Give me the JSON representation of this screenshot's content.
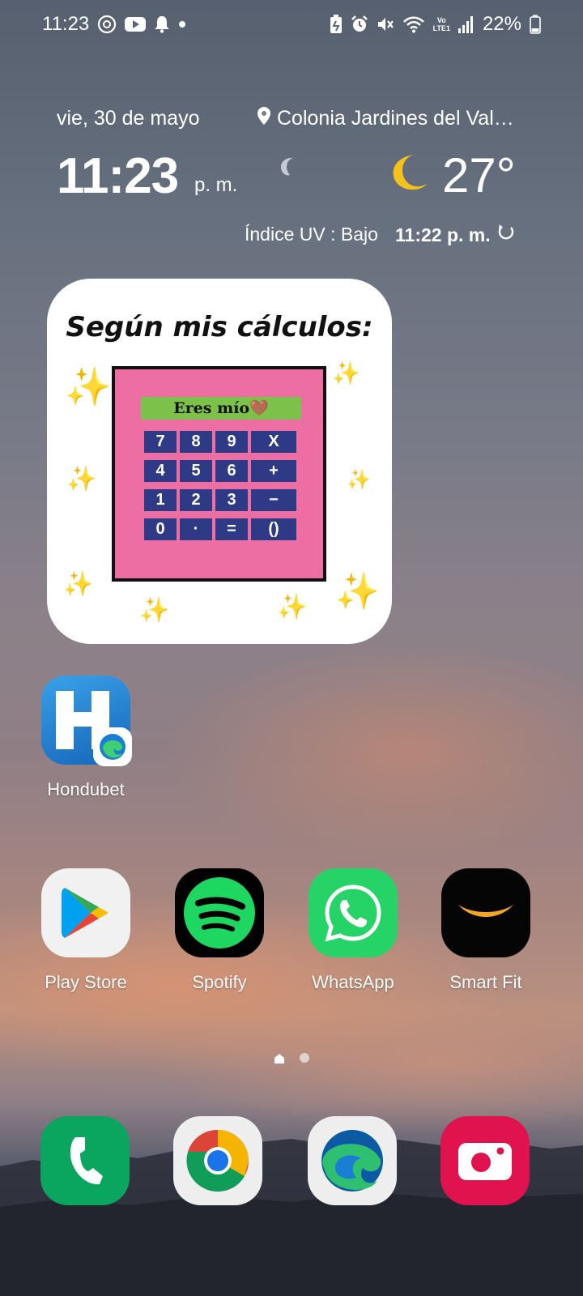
{
  "status_bar": {
    "time": "11:23",
    "battery": "22%",
    "left_icons": [
      "data-saver-icon",
      "youtube-icon",
      "bell-icon",
      "dot-icon"
    ],
    "right_icons": [
      "battery-saver-icon",
      "alarm-icon",
      "mute-icon",
      "wifi-icon",
      "volte-icon",
      "signal-icon",
      "battery-icon"
    ],
    "volte_top": "Vo",
    "volte_bottom": "LTE1"
  },
  "weather": {
    "date": "vie, 30 de mayo",
    "location": "Colonia Jardines del Val…",
    "time": "11:23",
    "ampm": "p. m.",
    "temperature": "27°",
    "uv": "Índice UV : Bajo",
    "updated": "11:22 p. m."
  },
  "photo_widget": {
    "title": "Según mis cálculos:",
    "display": "Eres mío🤎",
    "keys": [
      "7",
      "8",
      "9",
      "X",
      "4",
      "5",
      "6",
      "+",
      "1",
      "2",
      "3",
      "−",
      "0",
      "·",
      "=",
      "()"
    ]
  },
  "apps": {
    "hondubet": {
      "label": "Hondubet"
    },
    "play_store": {
      "label": "Play Store"
    },
    "spotify": {
      "label": "Spotify"
    },
    "whatsapp": {
      "label": "WhatsApp"
    },
    "smart_fit": {
      "label": "Smart Fit"
    }
  },
  "dock": [
    "phone-icon",
    "chrome-icon",
    "edge-icon",
    "camera-icon"
  ],
  "page_indicator": {
    "pages": 2,
    "current": 1
  },
  "colors": {
    "spotify_green": "#1ed760",
    "whatsapp_green": "#25d366",
    "phone_green": "#0aa55f",
    "camera_red": "#e0134f",
    "hondubet_blue": "#1d7fd0"
  }
}
